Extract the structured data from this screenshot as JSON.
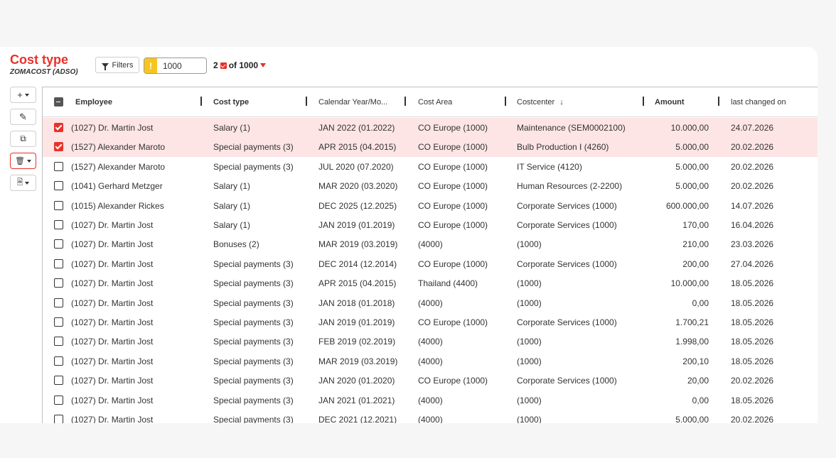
{
  "header": {
    "title": "Cost type",
    "subtitle": "ZOMACOST (ADSO)",
    "filters_label": "Filters",
    "limit_value": "1000",
    "limit_warning": "!",
    "selected_count": "2",
    "total_label": "of 1000"
  },
  "toolbar": {
    "add": "+",
    "edit": "✎",
    "copy": "⧉",
    "delete": "🗑",
    "export": "🗎"
  },
  "table": {
    "columns": [
      "Employee",
      "Cost type",
      "Calendar Year/Mo...",
      "Cost Area",
      "Costcenter",
      "Amount",
      "last changed on"
    ],
    "sort_indicator": "↓",
    "rows": [
      {
        "selected": true,
        "employee": "(1027) Dr. Martin Jost",
        "cost_type": "Salary (1)",
        "period": "JAN 2022 (01.2022)",
        "cost_area": "CO Europe (1000)",
        "costcenter": "Maintenance (SEM0002100)",
        "amount": "10.000,00",
        "changed": "24.07.2026"
      },
      {
        "selected": true,
        "employee": "(1527) Alexander Maroto",
        "cost_type": "Special payments (3)",
        "period": "APR 2015 (04.2015)",
        "cost_area": "CO Europe (1000)",
        "costcenter": "Bulb Production I (4260)",
        "amount": "5.000,00",
        "changed": "20.02.2026"
      },
      {
        "selected": false,
        "employee": "(1527) Alexander Maroto",
        "cost_type": "Special payments (3)",
        "period": "JUL 2020 (07.2020)",
        "cost_area": "CO Europe (1000)",
        "costcenter": "IT Service (4120)",
        "amount": "5.000,00",
        "changed": "20.02.2026"
      },
      {
        "selected": false,
        "employee": "(1041) Gerhard Metzger",
        "cost_type": "Salary (1)",
        "period": "MAR 2020 (03.2020)",
        "cost_area": "CO Europe (1000)",
        "costcenter": "Human Resources (2-2200)",
        "amount": "5.000,00",
        "changed": "20.02.2026"
      },
      {
        "selected": false,
        "employee": "(1015) Alexander Rickes",
        "cost_type": "Salary (1)",
        "period": "DEC 2025 (12.2025)",
        "cost_area": "CO Europe (1000)",
        "costcenter": "Corporate Services (1000)",
        "amount": "600.000,00",
        "changed": "14.07.2026"
      },
      {
        "selected": false,
        "employee": "(1027) Dr. Martin Jost",
        "cost_type": "Salary (1)",
        "period": "JAN 2019 (01.2019)",
        "cost_area": "CO Europe (1000)",
        "costcenter": "Corporate Services (1000)",
        "amount": "170,00",
        "changed": "16.04.2026"
      },
      {
        "selected": false,
        "employee": "(1027) Dr. Martin Jost",
        "cost_type": "Bonuses (2)",
        "period": "MAR 2019 (03.2019)",
        "cost_area": "(4000)",
        "costcenter": "(1000)",
        "amount": "210,00",
        "changed": "23.03.2026"
      },
      {
        "selected": false,
        "employee": "(1027) Dr. Martin Jost",
        "cost_type": "Special payments (3)",
        "period": "DEC 2014 (12.2014)",
        "cost_area": "CO Europe (1000)",
        "costcenter": "Corporate Services (1000)",
        "amount": "200,00",
        "changed": "27.04.2026"
      },
      {
        "selected": false,
        "employee": "(1027) Dr. Martin Jost",
        "cost_type": "Special payments (3)",
        "period": "APR 2015 (04.2015)",
        "cost_area": "Thailand (4400)",
        "costcenter": "(1000)",
        "amount": "10.000,00",
        "changed": "18.05.2026"
      },
      {
        "selected": false,
        "employee": "(1027) Dr. Martin Jost",
        "cost_type": "Special payments (3)",
        "period": "JAN 2018 (01.2018)",
        "cost_area": "(4000)",
        "costcenter": "(1000)",
        "amount": "0,00",
        "changed": "18.05.2026"
      },
      {
        "selected": false,
        "employee": "(1027) Dr. Martin Jost",
        "cost_type": "Special payments (3)",
        "period": "JAN 2019 (01.2019)",
        "cost_area": "CO Europe (1000)",
        "costcenter": "Corporate Services (1000)",
        "amount": "1.700,21",
        "changed": "18.05.2026"
      },
      {
        "selected": false,
        "employee": "(1027) Dr. Martin Jost",
        "cost_type": "Special payments (3)",
        "period": "FEB 2019 (02.2019)",
        "cost_area": "(4000)",
        "costcenter": "(1000)",
        "amount": "1.998,00",
        "changed": "18.05.2026"
      },
      {
        "selected": false,
        "employee": "(1027) Dr. Martin Jost",
        "cost_type": "Special payments (3)",
        "period": "MAR 2019 (03.2019)",
        "cost_area": "(4000)",
        "costcenter": "(1000)",
        "amount": "200,10",
        "changed": "18.05.2026"
      },
      {
        "selected": false,
        "employee": "(1027) Dr. Martin Jost",
        "cost_type": "Special payments (3)",
        "period": "JAN 2020 (01.2020)",
        "cost_area": "CO Europe (1000)",
        "costcenter": "Corporate Services (1000)",
        "amount": "20,00",
        "changed": "20.02.2026"
      },
      {
        "selected": false,
        "employee": "(1027) Dr. Martin Jost",
        "cost_type": "Special payments (3)",
        "period": "JAN 2021 (01.2021)",
        "cost_area": "(4000)",
        "costcenter": "(1000)",
        "amount": "0,00",
        "changed": "18.05.2026"
      },
      {
        "selected": false,
        "employee": "(1027) Dr. Martin Jost",
        "cost_type": "Special payments (3)",
        "period": "DEC 2021 (12.2021)",
        "cost_area": "(4000)",
        "costcenter": "(1000)",
        "amount": "5.000,00",
        "changed": "20.02.2026"
      }
    ]
  },
  "colors": {
    "accent": "#e8312a",
    "selected_row": "#fce5e4",
    "warning": "#f7c51f"
  }
}
